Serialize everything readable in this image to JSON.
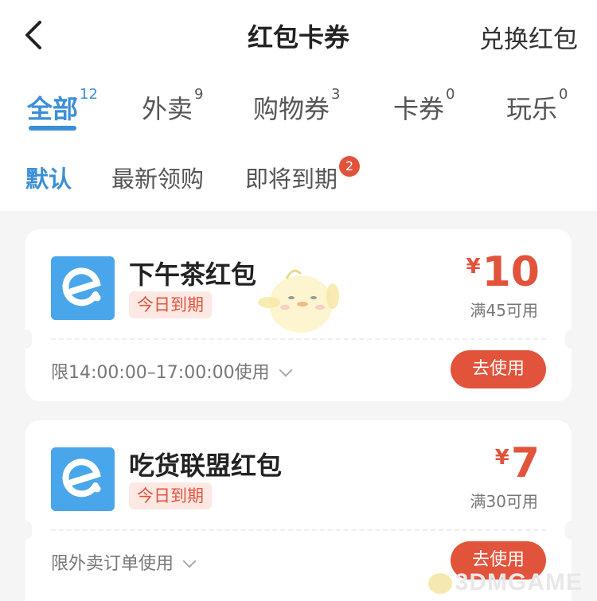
{
  "header": {
    "title": "红包卡券",
    "exchange_label": "兑换红包"
  },
  "tabs": [
    {
      "label": "全部",
      "count": "12"
    },
    {
      "label": "外卖",
      "count": "9"
    },
    {
      "label": "购物券",
      "count": "3"
    },
    {
      "label": "卡券",
      "count": "0"
    },
    {
      "label": "玩乐",
      "count": "0"
    }
  ],
  "filters": {
    "default": "默认",
    "newest": "最新领购",
    "expiring": "即将到期",
    "expiring_badge": "2"
  },
  "coupons": [
    {
      "name": "下午茶红包",
      "expire_tag": "今日到期",
      "currency": "¥",
      "amount": "10",
      "condition": "满45可用",
      "limit": "限14:00:00–17:00:00使用",
      "use_label": "去使用"
    },
    {
      "name": "吃货联盟红包",
      "expire_tag": "今日到期",
      "currency": "¥",
      "amount": "7",
      "condition": "满30可用",
      "limit": "限外卖订单使用",
      "use_label": "去使用"
    }
  ],
  "watermark": "3DMGAME",
  "colors": {
    "accent": "#3b8fd6",
    "danger": "#e2533b",
    "logo": "#4aa6ea"
  },
  "icons": {
    "back": "back-arrow-icon",
    "coupon_logo": "eleme-logo-icon",
    "limit_expand": "chevron-down-icon"
  }
}
